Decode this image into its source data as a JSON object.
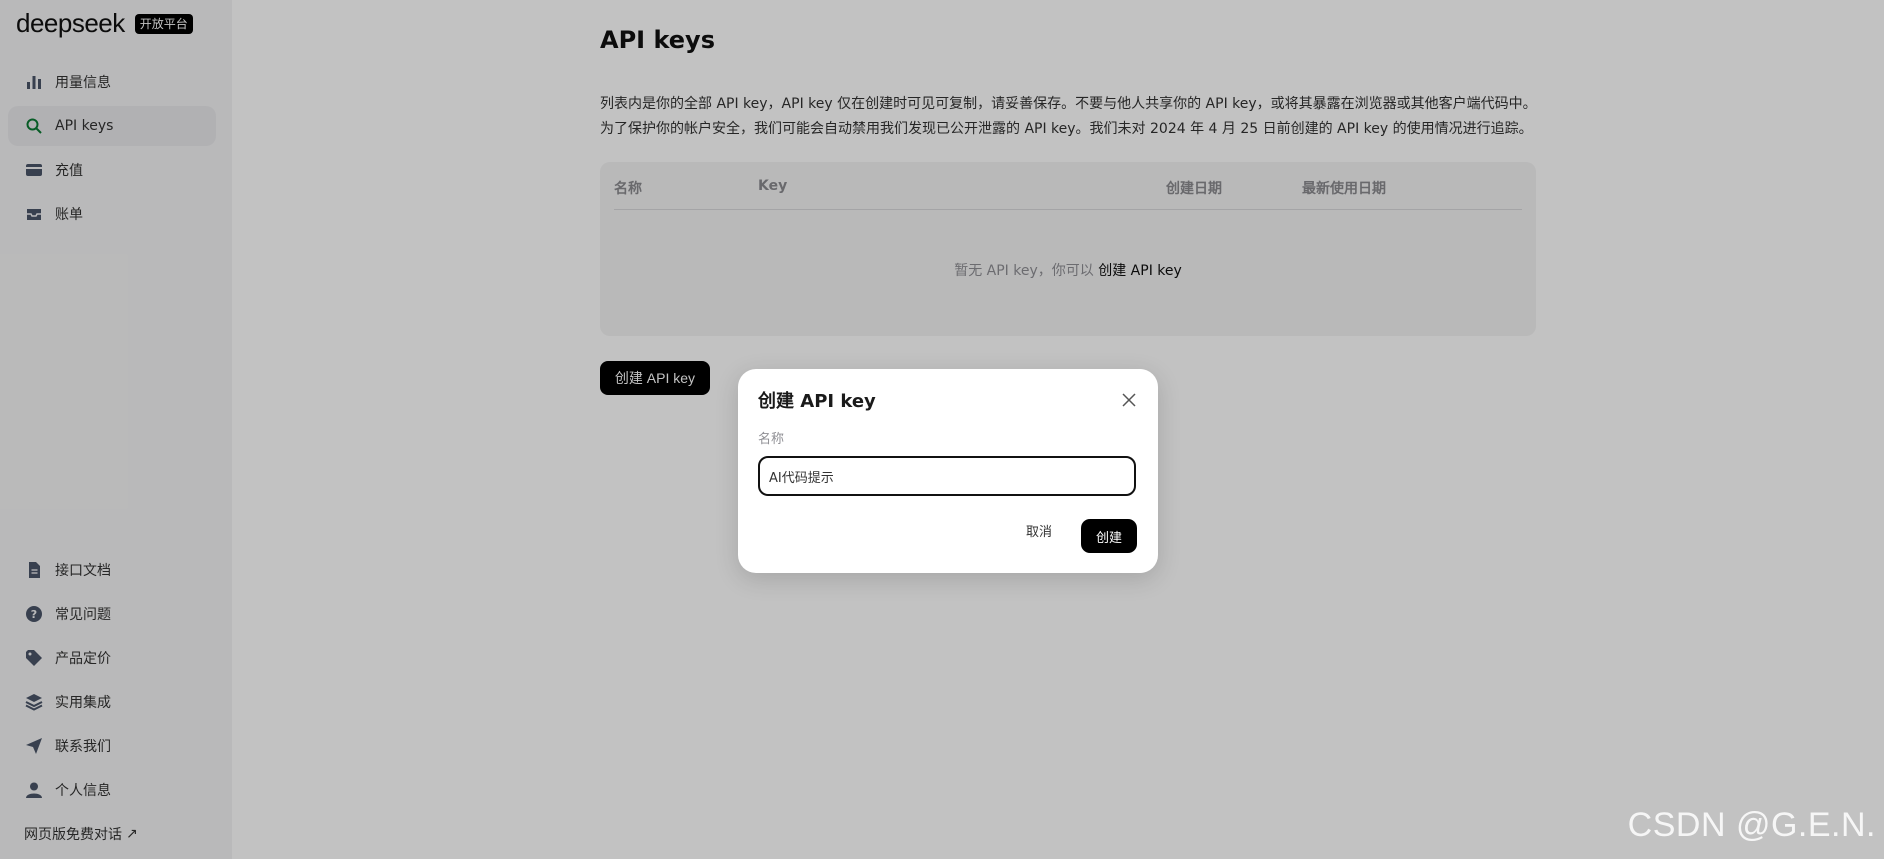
{
  "brand": {
    "logo": "deepseek",
    "badge": "开放平台"
  },
  "sidebar": {
    "items": [
      {
        "label": "用量信息",
        "icon": "bar-chart-icon",
        "active": false
      },
      {
        "label": "API keys",
        "icon": "search-icon",
        "active": true
      },
      {
        "label": "充值",
        "icon": "card-icon",
        "active": false
      },
      {
        "label": "账单",
        "icon": "inbox-icon",
        "active": false
      }
    ],
    "bottom_items": [
      {
        "label": "接口文档",
        "icon": "document-icon"
      },
      {
        "label": "常见问题",
        "icon": "question-icon"
      },
      {
        "label": "产品定价",
        "icon": "tag-icon"
      },
      {
        "label": "实用集成",
        "icon": "layers-icon"
      },
      {
        "label": "联系我们",
        "icon": "send-icon"
      },
      {
        "label": "个人信息",
        "icon": "user-icon"
      }
    ],
    "web_link": "网页版免费对话"
  },
  "main": {
    "title": "API keys",
    "desc_line1": "列表内是你的全部 API key，API key 仅在创建时可见可复制，请妥善保存。不要与他人共享你的 API key，或将其暴露在浏览器或其他客户端代码中。",
    "desc_line2": "为了保护你的帐户安全，我们可能会自动禁用我们发现已公开泄露的 API key。我们未对 2024 年 4 月 25 日前创建的 API key 的使用情况进行追踪。",
    "table": {
      "columns": [
        "名称",
        "Key",
        "创建日期",
        "最新使用日期"
      ],
      "empty_prefix": "暂无 API key，你可以 ",
      "empty_link": "创建 API key"
    },
    "create_button": "创建 API key"
  },
  "modal": {
    "title": "创建 API key",
    "field_label": "名称",
    "input_value": "AI代码提示",
    "cancel": "取消",
    "confirm": "创建"
  },
  "watermark": "CSDN @G.E.N.",
  "colors": {
    "accent": "#0a7a33",
    "primary_button": "#000000",
    "overlay": "#000000"
  }
}
